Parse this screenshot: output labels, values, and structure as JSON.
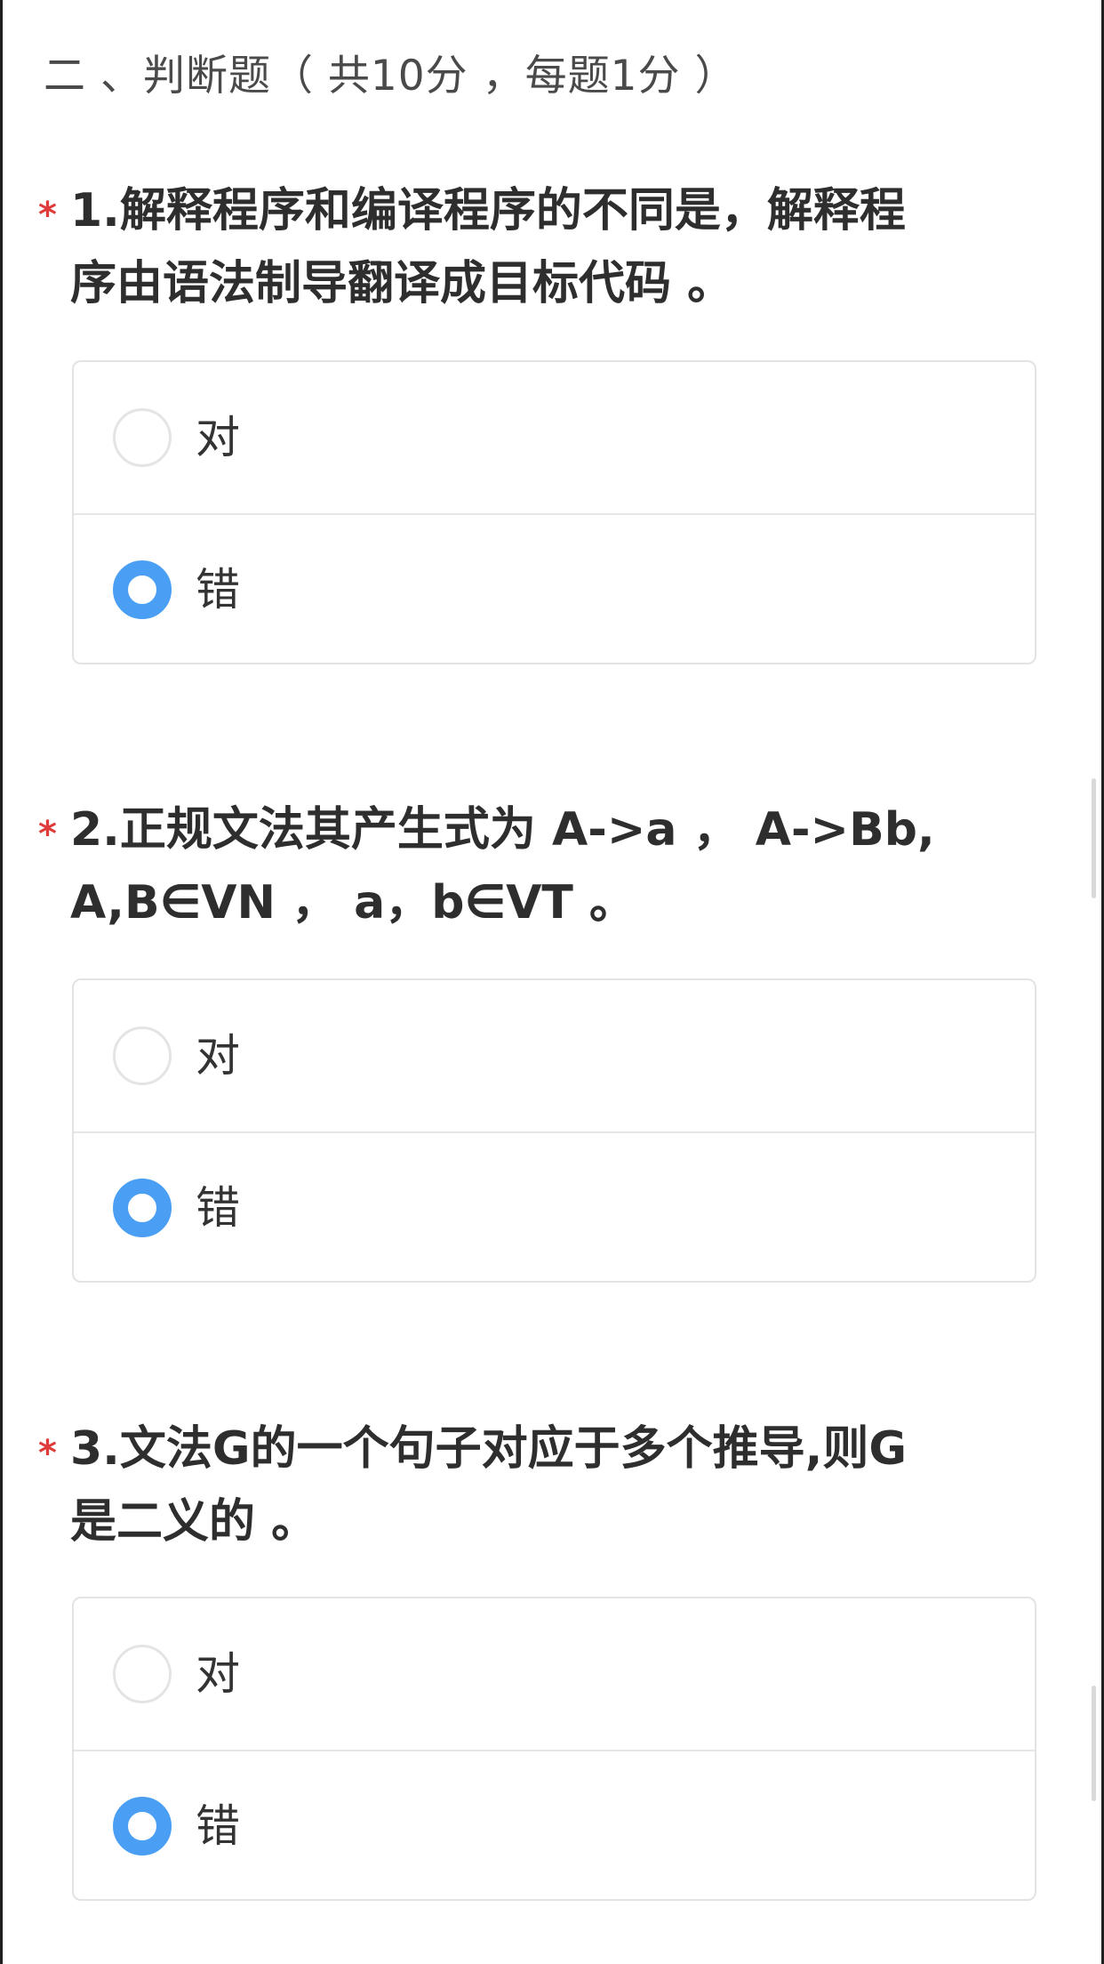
{
  "section": {
    "title": "二 、判断题（ 共10分 ，每题1分 ）"
  },
  "questions": [
    {
      "required_mark": "*",
      "stem_line1": "1.解释程序和编译程序的不同是，解释程",
      "stem_line2": "序由语法制导翻译成目标代码 。",
      "options": [
        {
          "label": "对",
          "selected": false
        },
        {
          "label": "错",
          "selected": true
        }
      ]
    },
    {
      "required_mark": "*",
      "stem_line1": "2.正规文法其产生式为 A->a ， A->Bb,",
      "stem_line2": "A,B∈VN ， a，b∈VT 。",
      "options": [
        {
          "label": "对",
          "selected": false
        },
        {
          "label": "错",
          "selected": true
        }
      ]
    },
    {
      "required_mark": "*",
      "stem_line1": "3.文法G的一个句子对应于多个推导,则G",
      "stem_line2": "是二义的 。",
      "options": [
        {
          "label": "对",
          "selected": false
        },
        {
          "label": "错",
          "selected": true
        }
      ]
    }
  ],
  "colors": {
    "accent": "#4a9ff5",
    "required": "#e03b3b",
    "border": "#e3e3e3"
  },
  "icons": {
    "unchecked": "radio-unchecked-icon",
    "checked": "radio-checked-icon"
  }
}
